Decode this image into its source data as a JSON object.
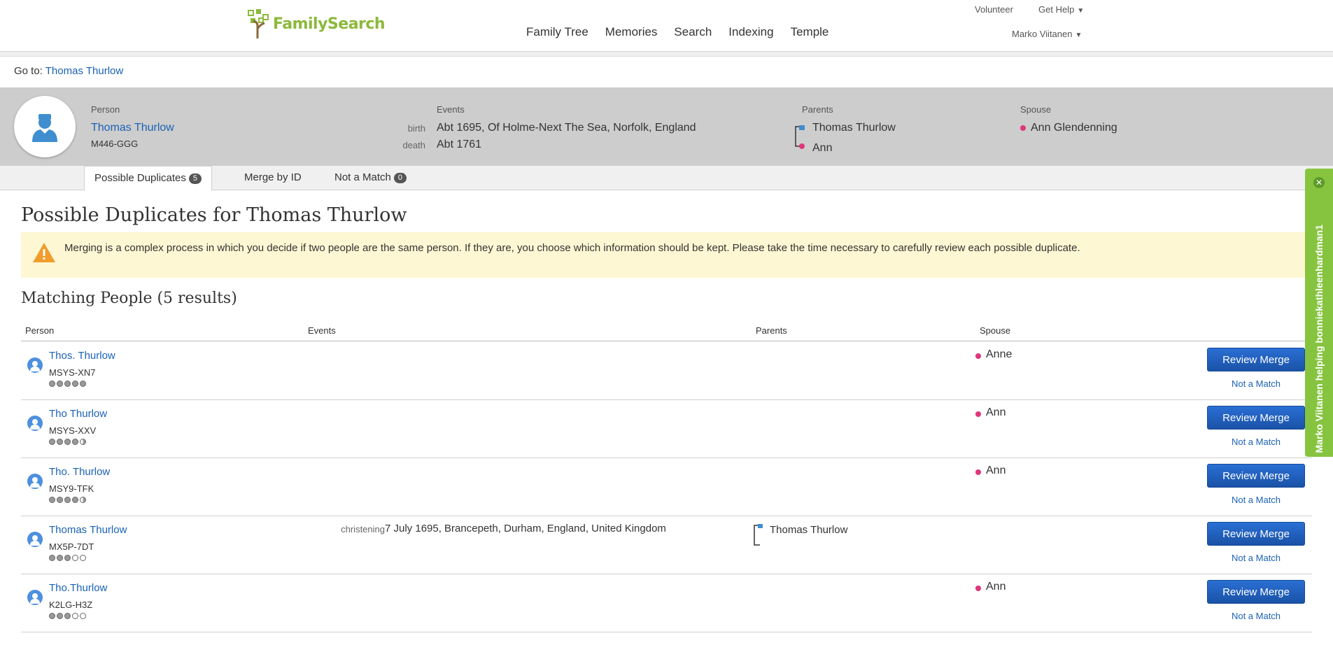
{
  "header": {
    "logo_text": "FamilySearch",
    "nav": [
      "Family Tree",
      "Memories",
      "Search",
      "Indexing",
      "Temple"
    ],
    "volunteer": "Volunteer",
    "get_help": "Get Help",
    "user": "Marko Viitanen"
  },
  "goto": {
    "label": "Go to:",
    "link": "Thomas Thurlow"
  },
  "person": {
    "label_person": "Person",
    "name": "Thomas Thurlow",
    "id": "M446-GGG",
    "label_events": "Events",
    "events": [
      {
        "type": "birth",
        "value": "Abt 1695, Of Holme-Next The Sea, Norfolk, England"
      },
      {
        "type": "death",
        "value": "Abt 1761"
      }
    ],
    "label_parents": "Parents",
    "father": "Thomas Thurlow",
    "mother": "Ann",
    "label_spouse": "Spouse",
    "spouse": "Ann Glendenning"
  },
  "tabs": [
    {
      "label": "Possible Duplicates",
      "count": "5"
    },
    {
      "label": "Merge by ID"
    },
    {
      "label": "Not a Match",
      "count": "0"
    }
  ],
  "main": {
    "title": "Possible Duplicates for Thomas Thurlow",
    "warning": "Merging is a complex process in which you decide if two people are the same person. If they are, you choose which information should be kept. Please take the time necessary to carefully review each possible duplicate.",
    "matching_title": "Matching People  (5 results)",
    "columns": [
      "Person",
      "Events",
      "Parents",
      "Spouse"
    ],
    "review_label": "Review Merge",
    "not_match_label": "Not a Match",
    "rows": [
      {
        "name": "Thos. Thurlow",
        "id": "MSYS-XN7",
        "rating": [
          "full",
          "full",
          "full",
          "full",
          "full"
        ],
        "event_type": "",
        "event_value": "",
        "parent": "",
        "spouse": "Anne"
      },
      {
        "name": "Tho Thurlow",
        "id": "MSYS-XXV",
        "rating": [
          "full",
          "full",
          "full",
          "full",
          "half"
        ],
        "event_type": "",
        "event_value": "",
        "parent": "",
        "spouse": "Ann"
      },
      {
        "name": "Tho. Thurlow",
        "id": "MSY9-TFK",
        "rating": [
          "full",
          "full",
          "full",
          "full",
          "half"
        ],
        "event_type": "",
        "event_value": "",
        "parent": "",
        "spouse": "Ann"
      },
      {
        "name": "Thomas Thurlow",
        "id": "MX5P-7DT",
        "rating": [
          "full",
          "full",
          "full",
          "empty",
          "empty"
        ],
        "event_type": "christening",
        "event_value": "7 July 1695, Brancepeth, Durham, England, United Kingdom",
        "parent": "Thomas Thurlow",
        "spouse": ""
      },
      {
        "name": "Tho.Thurlow",
        "id": "K2LG-H3Z",
        "rating": [
          "full",
          "full",
          "full",
          "empty",
          "empty"
        ],
        "event_type": "",
        "event_value": "",
        "parent": "",
        "spouse": "Ann"
      }
    ]
  },
  "helper": {
    "text": "Marko Viitanen helping bonniekathleenhardman1"
  },
  "colors": {
    "link": "#1a62b5",
    "button": "#1a52a7",
    "helper": "#86c440",
    "male": "#3e8ed0",
    "female": "#e0357a",
    "warning_bg": "#fdf7d3"
  }
}
